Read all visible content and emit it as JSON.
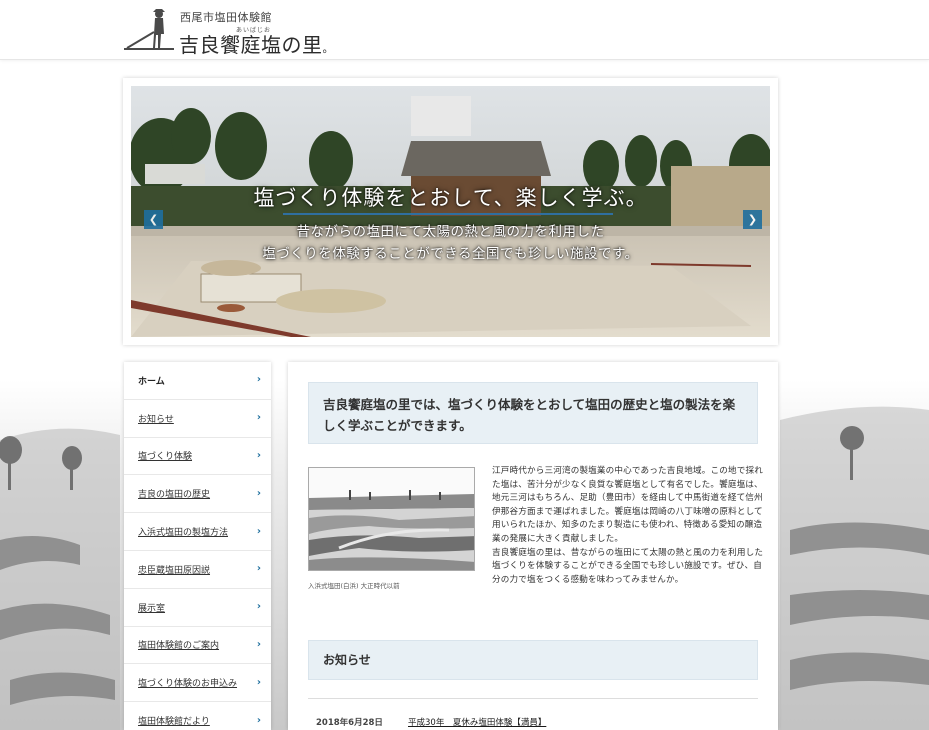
{
  "header": {
    "logo_subtitle": "西尾市塩田体験館",
    "logo_ruby": "あいばじお",
    "logo_title": "吉良饗庭塩の里",
    "logo_mark": "。"
  },
  "hero": {
    "headline": "塩づくり体験をとおして、楽しく学ぶ。",
    "subline1": "昔ながらの塩田にて太陽の熱と風の力を利用した",
    "subline2": "塩づくりを体験することができる全国でも珍しい施設です。",
    "prev_icon": "chevron-left-icon",
    "next_icon": "chevron-right-icon"
  },
  "sidebar": {
    "items": [
      {
        "label": "ホーム"
      },
      {
        "label": "お知らせ"
      },
      {
        "label": "塩づくり体験"
      },
      {
        "label": "吉良の塩田の歴史"
      },
      {
        "label": "入浜式塩田の製塩方法"
      },
      {
        "label": "忠臣蔵塩田原因説"
      },
      {
        "label": "展示室"
      },
      {
        "label": "塩田体験館のご案内"
      },
      {
        "label": "塩づくり体験のお申込み"
      },
      {
        "label": "塩田体験館だより"
      }
    ]
  },
  "main": {
    "intro": "吉良饗庭塩の里では、塩づくり体験をとおして塩田の歴史と塩の製法を楽しく学ぶことができます。",
    "photo_caption": "入浜式塩田(白浜) 大正時代以前",
    "paragraphs": [
      "江戸時代から三河湾の製塩業の中心であった吉良地域。この地で採れた塩は、苦汁分が少なく良質な饗庭塩として有名でした。饗庭塩は、地元三河はもちろん、足助（豊田市）を経由して中馬街道を経て信州伊那谷方面まで運ばれました。饗庭塩は岡崎の八丁味噌の原料として用いられたほか、知多のたまり製造にも使われ、特徴ある愛知の醸造業の発展に大きく貢献しました。",
      "吉良饗庭塩の里は、昔ながらの塩田にて太陽の熱と風の力を利用した塩づくりを体験することができる全国でも珍しい施設です。ぜひ、自分の力で塩をつくる感動を味わってみませんか。"
    ],
    "news_heading": "お知らせ",
    "news": [
      {
        "date": "2018年6月28日",
        "title": "平成30年　夏休み塩田体験【満員】"
      }
    ]
  },
  "colors": {
    "accent": "#1f6f9e",
    "box_bg": "#e8f0f5"
  }
}
